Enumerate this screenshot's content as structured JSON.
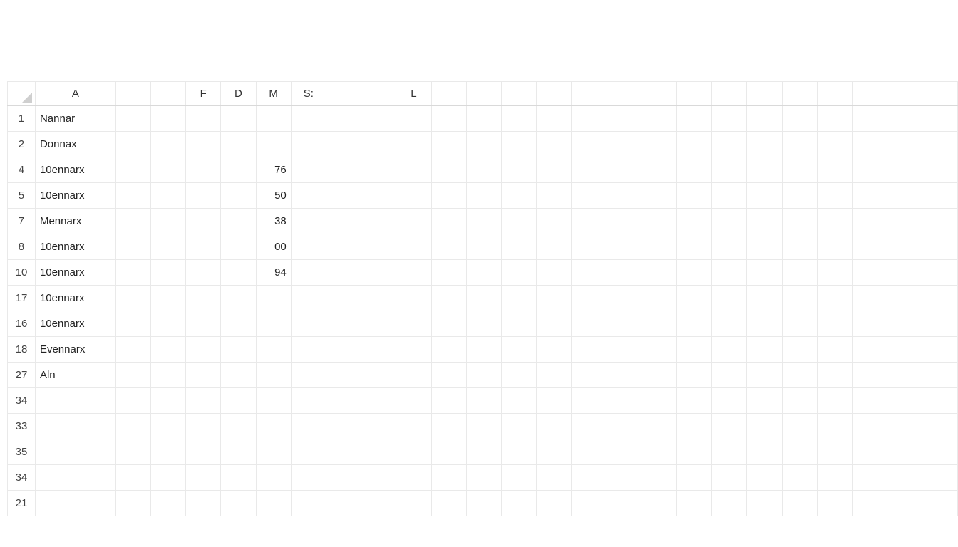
{
  "colHeaders": [
    "A",
    "",
    "",
    "F",
    "D",
    "M",
    "S:",
    "",
    "",
    "L",
    "",
    "",
    "",
    "",
    "",
    "",
    "",
    "",
    "",
    "",
    "",
    "",
    "",
    "",
    ""
  ],
  "rows": [
    {
      "hdr": "1",
      "a": "Nannar",
      "m": ""
    },
    {
      "hdr": "2",
      "a": "Donnax",
      "m": ""
    },
    {
      "hdr": "4",
      "a": "10ennarx",
      "m": "76"
    },
    {
      "hdr": "5",
      "a": "10ennarx",
      "m": "50"
    },
    {
      "hdr": "7",
      "a": "Mennarx",
      "m": "38"
    },
    {
      "hdr": "8",
      "a": "10ennarx",
      "m": "00"
    },
    {
      "hdr": "10",
      "a": "10ennarx",
      "m": "94"
    },
    {
      "hdr": "17",
      "a": "10ennarx",
      "m": ""
    },
    {
      "hdr": "16",
      "a": "10ennarx",
      "m": ""
    },
    {
      "hdr": "18",
      "a": "Evennarx",
      "m": ""
    },
    {
      "hdr": "27",
      "a": "Aln",
      "m": ""
    },
    {
      "hdr": "34",
      "a": "",
      "m": ""
    },
    {
      "hdr": "33",
      "a": "",
      "m": ""
    },
    {
      "hdr": "35",
      "a": "",
      "m": ""
    },
    {
      "hdr": "34",
      "a": "",
      "m": ""
    },
    {
      "hdr": "21",
      "a": "",
      "m": ""
    }
  ]
}
